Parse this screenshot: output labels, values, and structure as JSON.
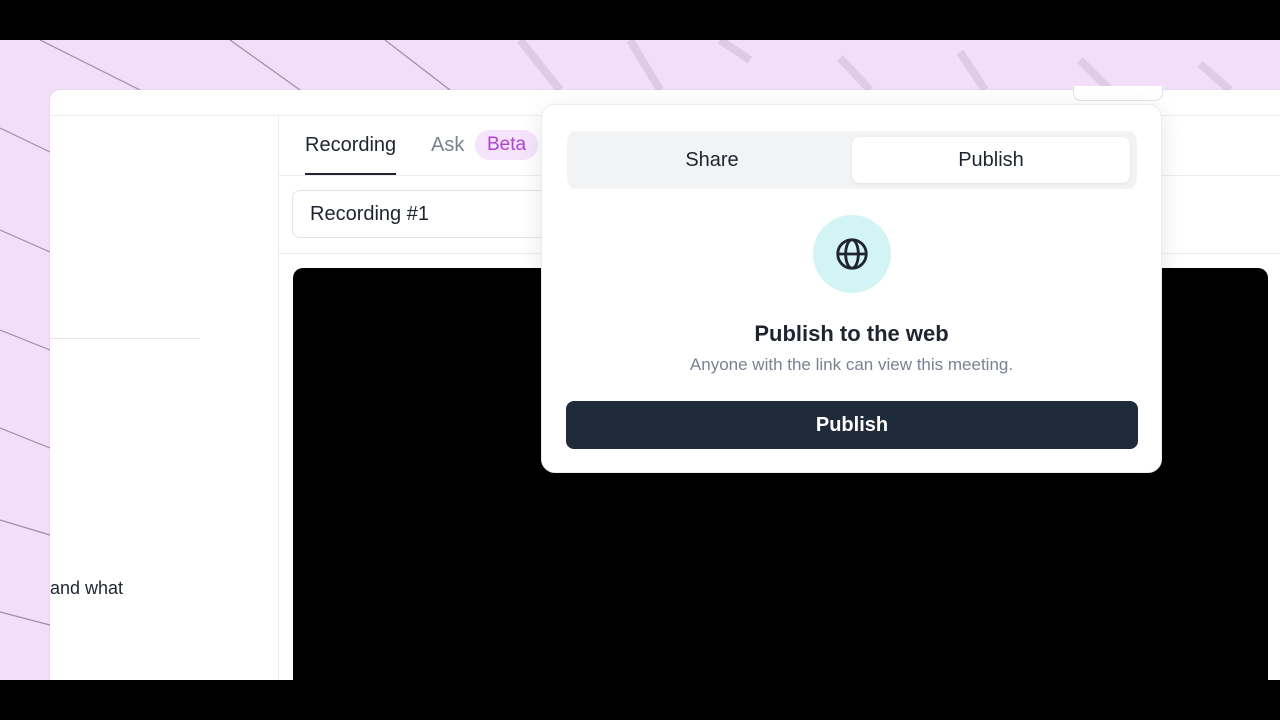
{
  "tabs": {
    "recording_label": "Recording",
    "ask_label": "Ask",
    "ask_badge": "Beta"
  },
  "recording": {
    "title_value": "Recording #1"
  },
  "sidebar": {
    "snippet_text": "and what"
  },
  "popover": {
    "segments": {
      "share_label": "Share",
      "publish_label": "Publish",
      "active": "Publish"
    },
    "icon": "globe-icon",
    "title": "Publish to the web",
    "subtitle": "Anyone with the link can view this meeting.",
    "button_label": "Publish"
  },
  "colors": {
    "backdrop": "#f3def7",
    "accent_dark": "#1f2a3a",
    "badge_bg": "#f5e4fb",
    "badge_text": "#b043d6",
    "icon_circle": "#d3f4f5",
    "muted_text": "#7b8192"
  }
}
